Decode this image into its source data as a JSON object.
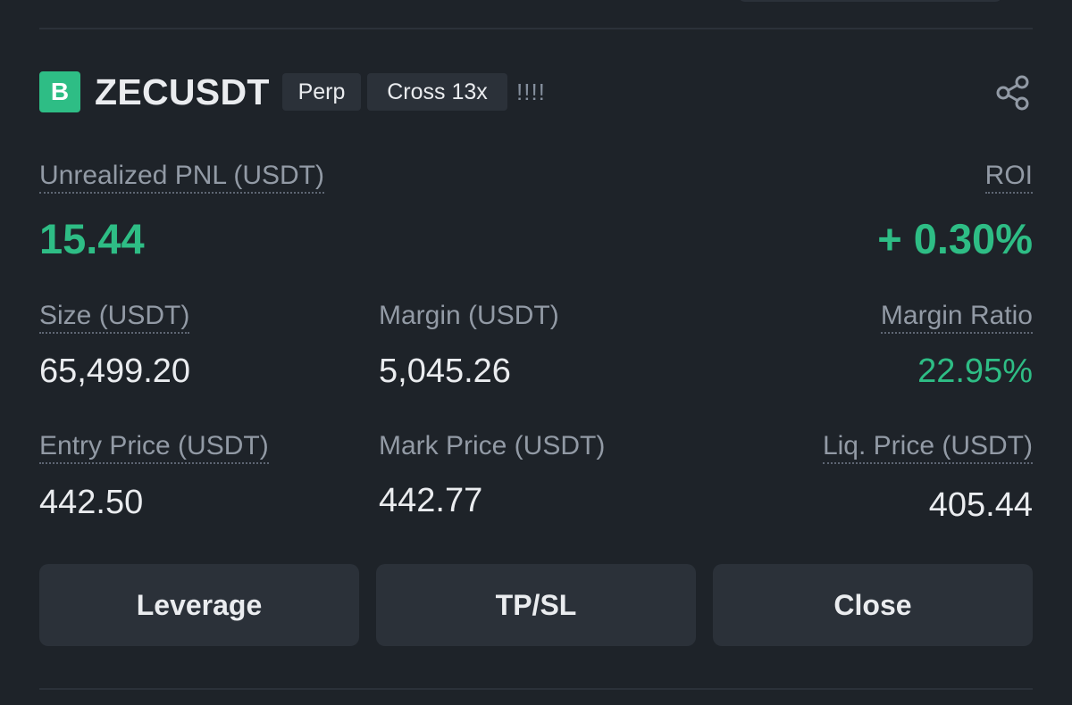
{
  "position": {
    "side": "B",
    "symbol": "ZECUSDT",
    "contract_type": "Perp",
    "margin_mode": "Cross 13x",
    "alert_marks": "!!!!",
    "share_icon": "share-icon"
  },
  "pnl": {
    "label": "Unrealized PNL (USDT)",
    "value": "15.44",
    "roi_label": "ROI",
    "roi_value": "+ 0.30%"
  },
  "stats": {
    "size_label": "Size (USDT)",
    "size_value": "65,499.20",
    "margin_label": "Margin (USDT)",
    "margin_value": "5,045.26",
    "margin_ratio_label": "Margin Ratio",
    "margin_ratio_value": "22.95%",
    "entry_price_label": "Entry Price (USDT)",
    "entry_price_value": "442.50",
    "mark_price_label": "Mark Price (USDT)",
    "mark_price_value": "442.77",
    "liq_price_label": "Liq. Price (USDT)",
    "liq_price_value": "405.44"
  },
  "actions": {
    "leverage_label": "Leverage",
    "tpsl_label": "TP/SL",
    "close_label": "Close"
  },
  "colors": {
    "background": "#1e2329",
    "surface": "#2b3139",
    "positive": "#2ebd85",
    "text_primary": "#eaecef",
    "text_secondary": "#929aa5"
  }
}
